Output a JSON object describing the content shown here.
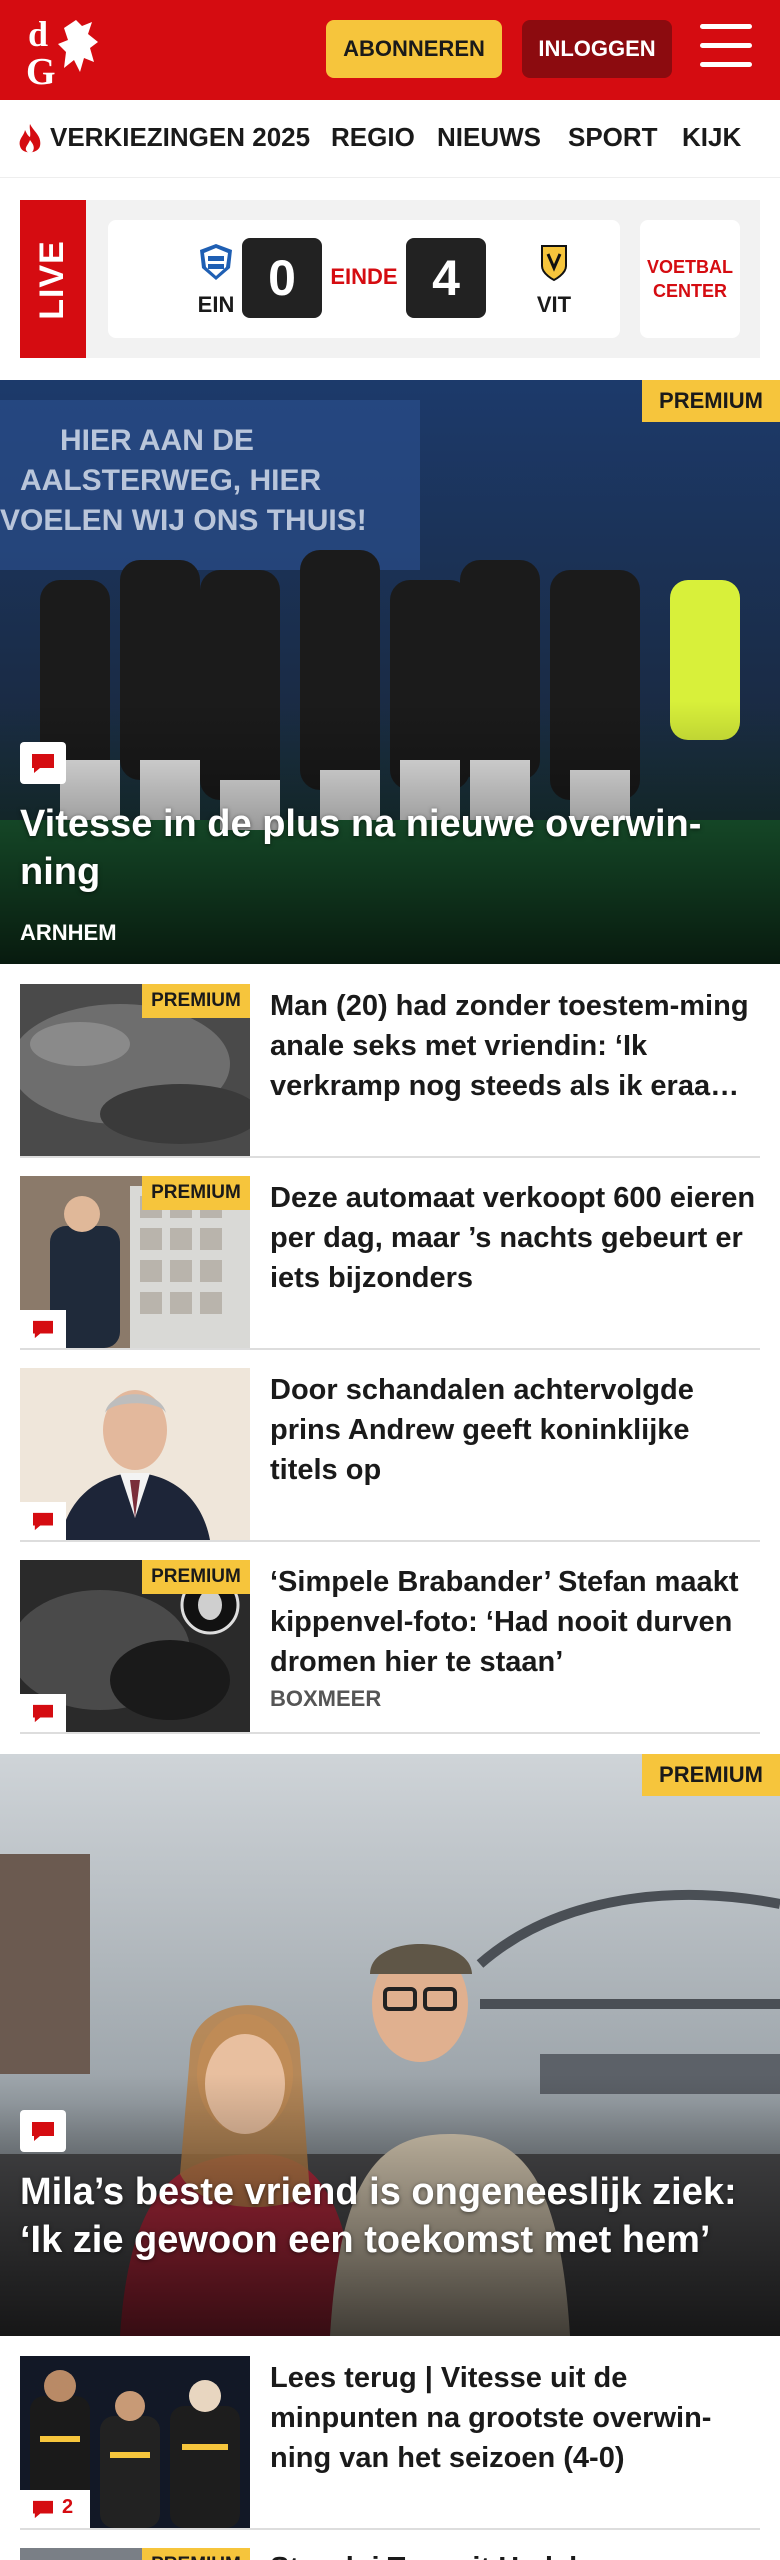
{
  "header": {
    "logo_text": "dG",
    "subscribe_label": "ABONNEREN",
    "login_label": "INLOGGEN",
    "menu_icon": "hamburger-menu-icon",
    "brand_color": "#d50c11"
  },
  "nav": {
    "items": [
      {
        "label": "VERKIEZINGEN 2025",
        "icon": "flame-icon"
      },
      {
        "label": "REGIO"
      },
      {
        "label": "NIEUWS"
      },
      {
        "label": "SPORT"
      },
      {
        "label": "KIJK"
      }
    ]
  },
  "live": {
    "tag": "LIVE",
    "home_team": "EIN",
    "home_score": "0",
    "status": "EINDE",
    "away_score": "4",
    "away_team": "VIT",
    "center_line1": "VOETBAL",
    "center_line2": "CENTER"
  },
  "hero1": {
    "premium": "PREMIUM",
    "title": "Vitesse in de plus na nieuwe overwin-ning",
    "location": "ARNHEM"
  },
  "articles": [
    {
      "premium": "PREMIUM",
      "title": "Man (20) had zonder toestem-ming anale seks met vriendin: ‘Ik verkramp nog steeds als ik eraa…",
      "comment": false
    },
    {
      "premium": "PREMIUM",
      "title": "Deze automaat verkoopt 600 eieren per dag, maar ’s nachts gebeurt er iets bijzonders",
      "comment": true
    },
    {
      "premium": "",
      "title": "Door schandalen achtervolgde prins Andrew geeft koninklijke titels op",
      "comment": true
    },
    {
      "premium": "PREMIUM",
      "title": "‘Simpele Brabander’ Stefan maakt kippenvel-foto: ‘Had nooit durven dromen hier te staan’",
      "location": "BOXMEER",
      "comment": true
    }
  ],
  "hero2": {
    "premium": "PREMIUM",
    "title": "Mila’s beste vriend is ongeneeslijk ziek: ‘Ik zie gewoon een toekomst met hem’"
  },
  "article_last": {
    "title": "Lees terug | Vitesse uit de minpunten na grootste overwin-ning van het seizoen (4-0)",
    "comment_count": "2"
  },
  "article_peek": {
    "premium": "PREMIUM",
    "title": "Stuurlui Tom uit Hedel"
  }
}
